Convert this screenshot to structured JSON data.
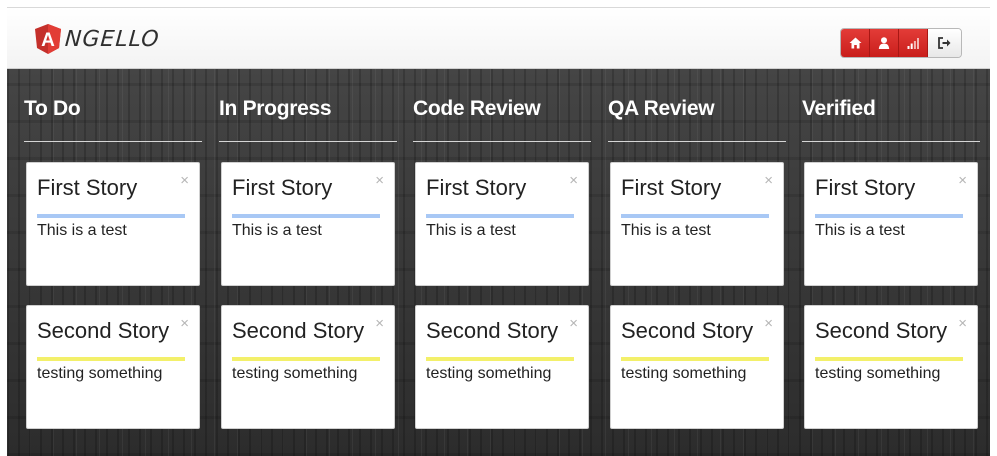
{
  "app": {
    "logo_text": "NGELLO",
    "logo_initial": "A"
  },
  "nav": {
    "icons": [
      "home-icon",
      "user-icon",
      "signal-icon",
      "logout-icon"
    ],
    "accent": "#d2322d"
  },
  "columns": [
    {
      "title": "To Do"
    },
    {
      "title": "In Progress"
    },
    {
      "title": "Code Review"
    },
    {
      "title": "QA Review"
    },
    {
      "title": "Verified"
    }
  ],
  "stories": [
    {
      "title": "First Story",
      "description": "This is a test",
      "color": "#a8c8f5",
      "close": "×"
    },
    {
      "title": "Second Story",
      "description": "testing something",
      "color": "#f3f06a",
      "close": "×"
    }
  ]
}
